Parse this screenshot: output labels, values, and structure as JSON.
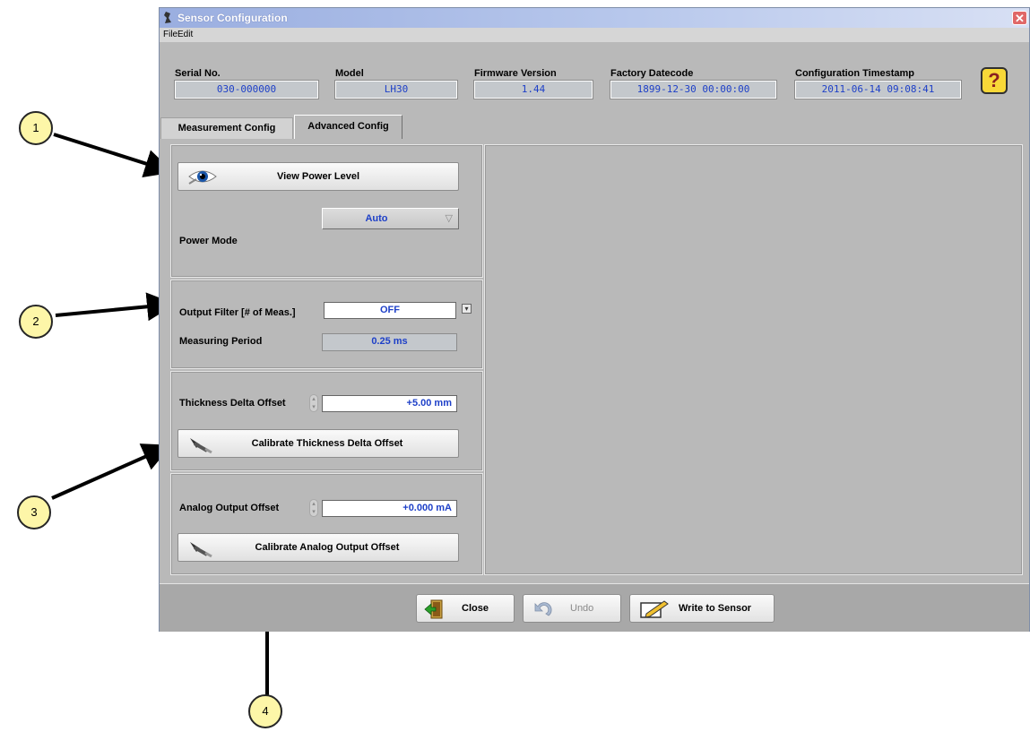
{
  "window": {
    "title": "Sensor Configuration",
    "close_glyph": "✕"
  },
  "menu": {
    "file": "File",
    "edit": "Edit"
  },
  "header": {
    "serial": {
      "label": "Serial No.",
      "value": "030-000000"
    },
    "model": {
      "label": "Model",
      "value": "LH30"
    },
    "firmware": {
      "label": "Firmware Version",
      "value": "1.44"
    },
    "datecode": {
      "label": "Factory Datecode",
      "value": "1899-12-30 00:00:00"
    },
    "timestamp": {
      "label": "Configuration Timestamp",
      "value": "2011-06-14 09:08:41"
    },
    "help_glyph": "?"
  },
  "tabs": [
    {
      "label": "Measurement Config"
    },
    {
      "label": "Advanced Config"
    }
  ],
  "power": {
    "view_power_label": "View Power Level",
    "mode_label": "Power Mode",
    "mode_value": "Auto"
  },
  "output": {
    "filter_label": "Output Filter [# of Meas.]",
    "filter_value": "OFF",
    "period_label": "Measuring Period",
    "period_value": "0.25 ms"
  },
  "thickness": {
    "label": "Thickness Delta Offset",
    "value": "+5.00 mm",
    "calibrate_label": "Calibrate Thickness Delta Offset"
  },
  "analog": {
    "label": "Analog Output Offset",
    "value": "+0.000 mA",
    "calibrate_label": "Calibrate Analog Output Offset"
  },
  "footer": {
    "close_label": "Close",
    "undo_label": "Undo",
    "write_label": "Write to Sensor"
  },
  "callouts": [
    "1",
    "2",
    "3",
    "4"
  ],
  "icons": {
    "app": "app-icon",
    "eye": "eye-icon",
    "calibrate": "caliper-icon",
    "close": "door-exit-icon",
    "undo": "undo-arrow-icon",
    "write": "pencil-write-icon",
    "dropdown": "chevron-down-icon",
    "help": "question-mark-icon"
  },
  "colors": {
    "value_text": "#1e40c8",
    "panel_bg": "#b9b9b9",
    "callout_fill": "#fdf6a8"
  }
}
